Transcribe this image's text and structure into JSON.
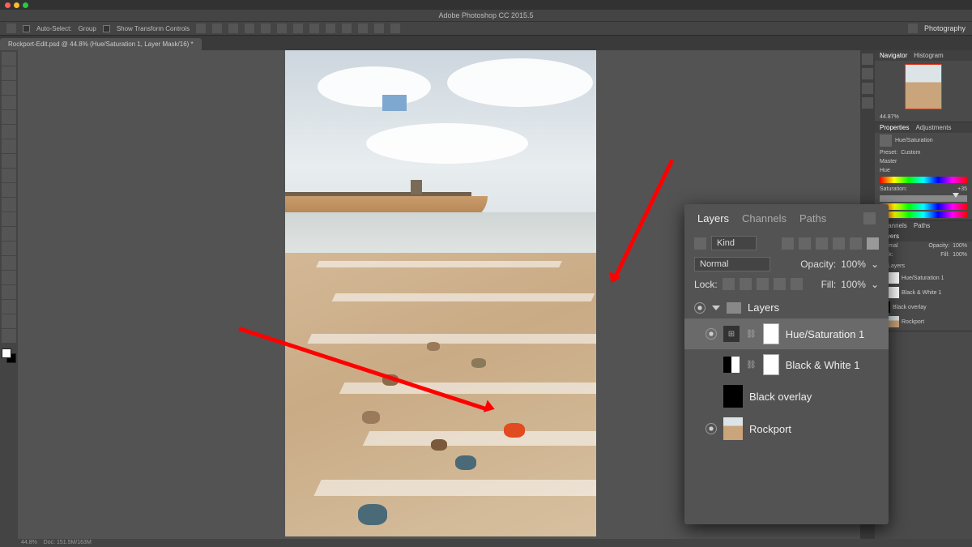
{
  "app": {
    "title": "Adobe Photoshop CC 2015.5"
  },
  "window_controls": {
    "close": "close",
    "min": "minimize",
    "max": "maximize"
  },
  "options_bar": {
    "auto_select_label": "Auto-Select:",
    "auto_select_mode": "Group",
    "show_transform": "Show Transform Controls",
    "workspace": "Photography"
  },
  "document_tab": "Rockport-Edit.psd @ 44.8% (Hue/Saturation 1, Layer Mask/16) *",
  "status": {
    "zoom": "44.8%",
    "doc": "Doc: 151.5M/163M"
  },
  "right_tabs": {
    "navigator": "Navigator",
    "histogram": "Histogram",
    "properties": "Properties",
    "adjustments": "Adjustments",
    "channels": "Channels",
    "paths": "Paths",
    "layers": "Layers"
  },
  "properties": {
    "type_label": "Hue/Saturation",
    "preset_label": "Preset:",
    "preset_value": "Custom",
    "channel_value": "Master",
    "hue_label": "Hue",
    "saturation_label": "Saturation:",
    "saturation_value": "+35"
  },
  "mini_layers": {
    "blend": "Normal",
    "opacity_label": "Opacity:",
    "opacity": "100%",
    "lock_label": "Lock:",
    "fill_label": "Fill:",
    "fill": "100%",
    "items": [
      {
        "name": "Hue/Saturation 1"
      },
      {
        "name": "Black & White 1"
      },
      {
        "name": "Black overlay"
      },
      {
        "name": "Rockport"
      }
    ],
    "group": "Layers"
  },
  "layers_popup": {
    "tabs": {
      "layers": "Layers",
      "channels": "Channels",
      "paths": "Paths"
    },
    "filter_label": "Kind",
    "blend_mode": "Normal",
    "opacity_label": "Opacity:",
    "opacity_value": "100%",
    "lock_label": "Lock:",
    "fill_label": "Fill:",
    "fill_value": "100%",
    "group_name": "Layers",
    "items": [
      {
        "name": "Hue/Saturation 1"
      },
      {
        "name": "Black & White 1"
      },
      {
        "name": "Black overlay"
      },
      {
        "name": "Rockport"
      }
    ]
  },
  "nav_zoom": "44.87%"
}
